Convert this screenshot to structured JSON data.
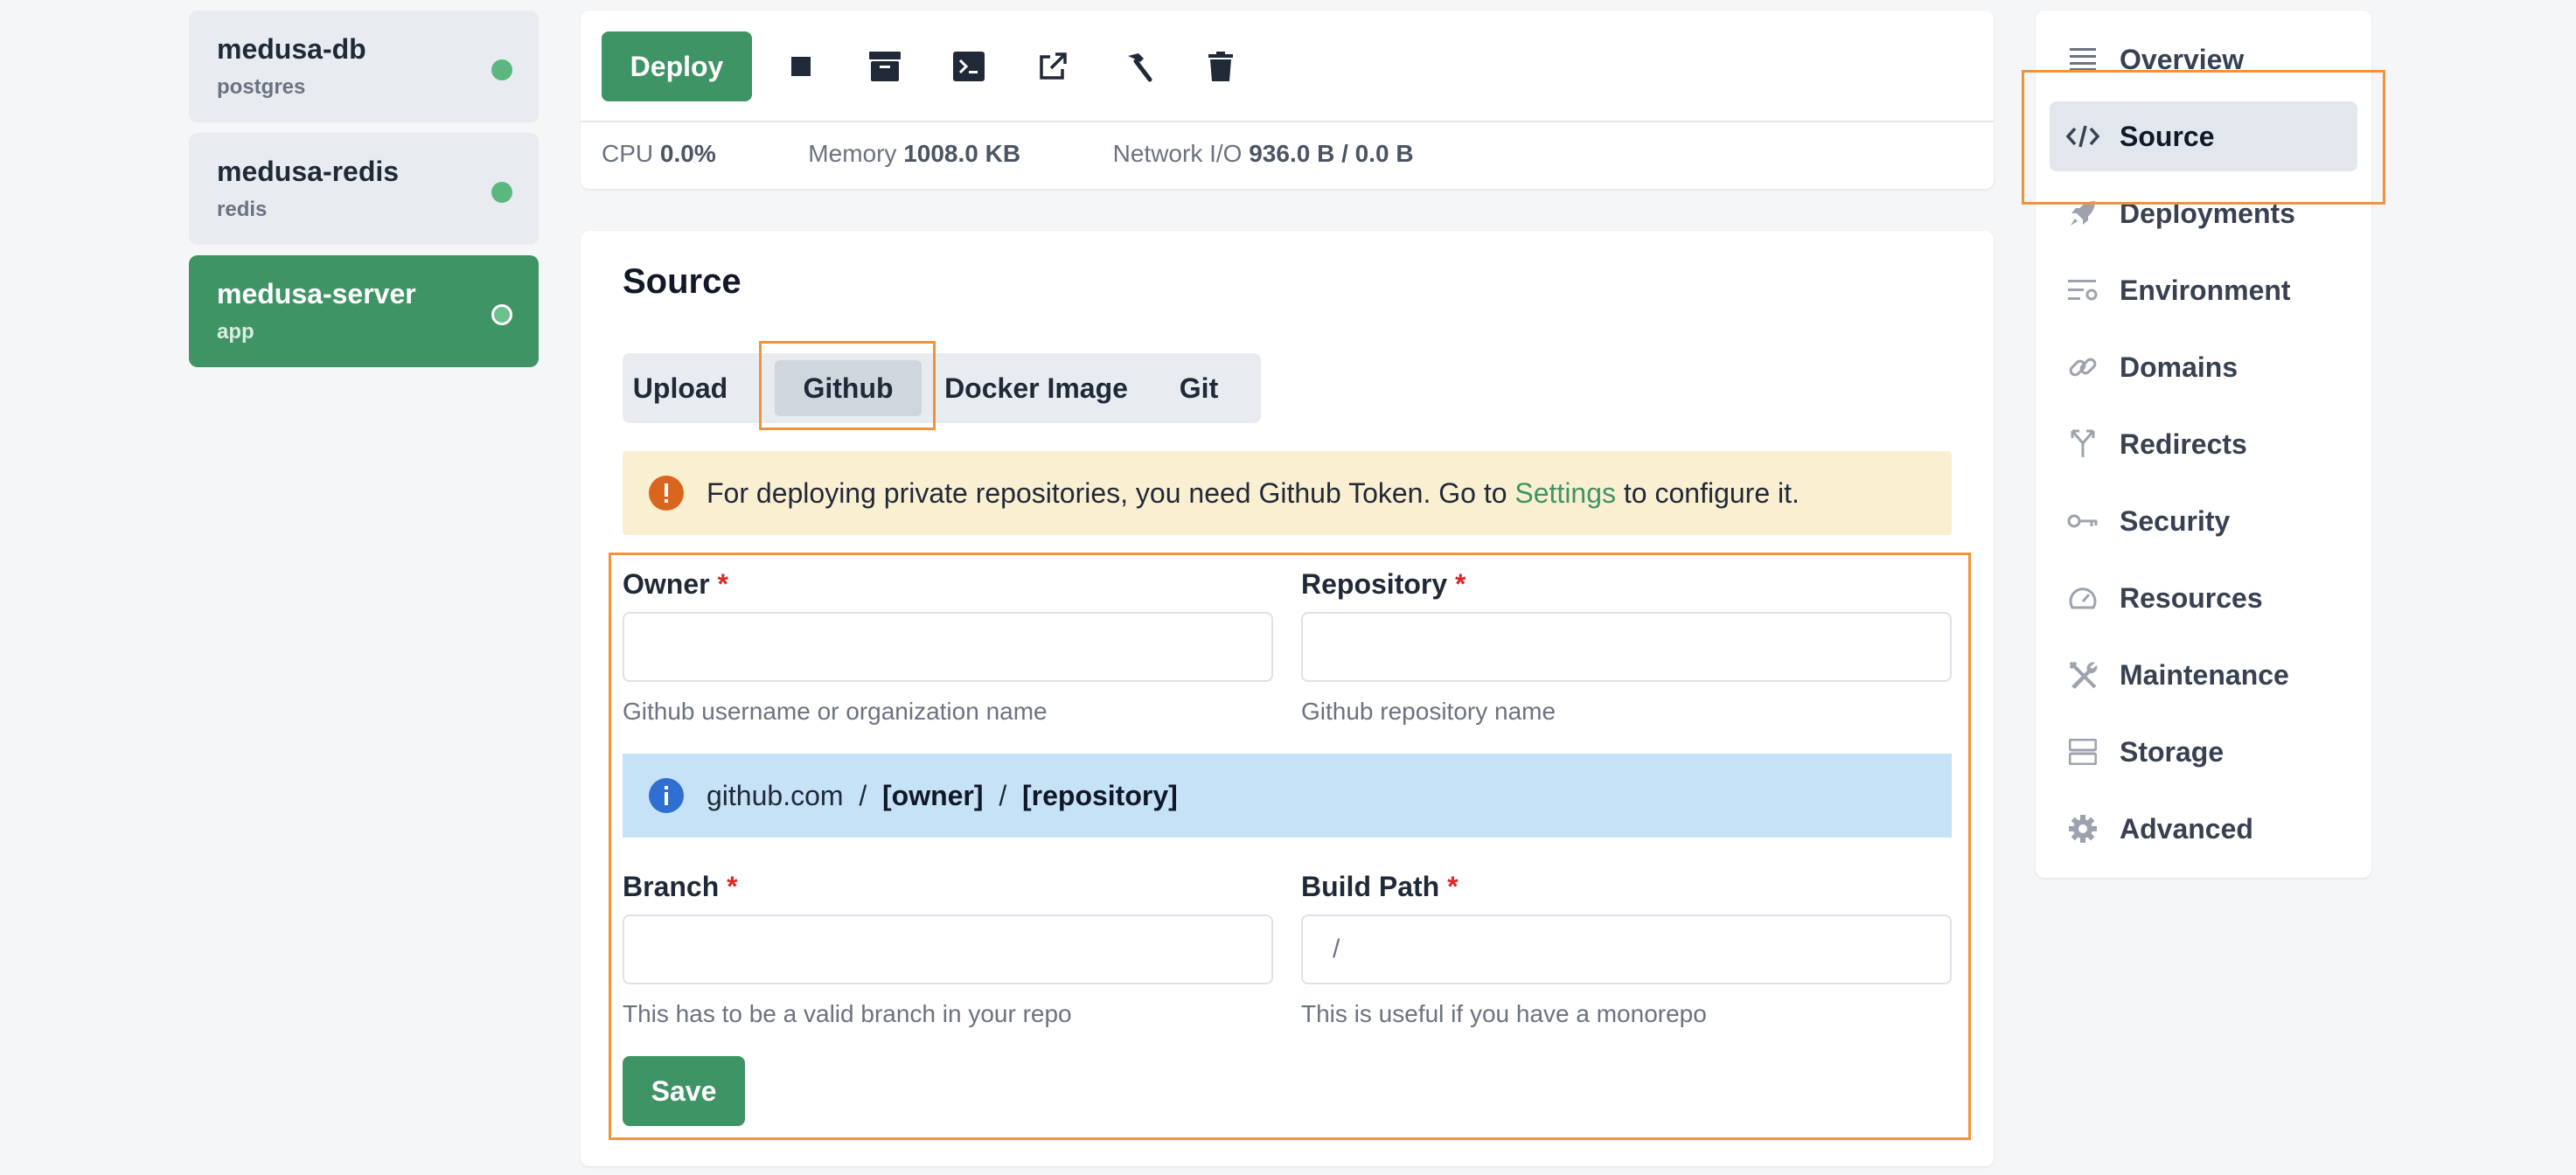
{
  "services": [
    {
      "name": "medusa-db",
      "type": "postgres"
    },
    {
      "name": "medusa-redis",
      "type": "redis"
    },
    {
      "name": "medusa-server",
      "type": "app"
    }
  ],
  "toolbar": {
    "deploy_label": "Deploy",
    "icons": [
      "stop-icon",
      "archive-icon",
      "terminal-icon",
      "external-link-icon",
      "hammer-icon",
      "trash-icon"
    ]
  },
  "stats": {
    "cpu_label": "CPU",
    "cpu_value": "0.0%",
    "memory_label": "Memory",
    "memory_value": "1008.0 KB",
    "network_label": "Network I/O",
    "network_value": "936.0 B / 0.0 B"
  },
  "source": {
    "title": "Source",
    "tabs": [
      "Upload",
      "Github",
      "Docker Image",
      "Git"
    ],
    "active_tab": "Github",
    "warning": {
      "before": "For deploying private repositories, you need Github Token. Go to ",
      "link": "Settings",
      "after": " to configure it."
    },
    "owner": {
      "label": "Owner",
      "hint": "Github username or organization name",
      "value": ""
    },
    "repository": {
      "label": "Repository",
      "hint": "Github repository name",
      "value": ""
    },
    "url_preview": {
      "domain": "github.com",
      "sep": "/",
      "owner": "[owner]",
      "repo": "[repository]"
    },
    "branch": {
      "label": "Branch",
      "hint": "This has to be a valid branch in your repo",
      "value": ""
    },
    "build_path": {
      "label": "Build Path",
      "hint": "This is useful if you have a monorepo",
      "value": "/"
    },
    "required_mark": "*",
    "save_label": "Save"
  },
  "nav": [
    {
      "label": "Overview",
      "icon": "list-icon"
    },
    {
      "label": "Source",
      "icon": "code-icon",
      "active": true
    },
    {
      "label": "Deployments",
      "icon": "rocket-icon"
    },
    {
      "label": "Environment",
      "icon": "env-settings-icon"
    },
    {
      "label": "Domains",
      "icon": "link-icon"
    },
    {
      "label": "Redirects",
      "icon": "redirect-icon"
    },
    {
      "label": "Security",
      "icon": "key-icon"
    },
    {
      "label": "Resources",
      "icon": "gauge-icon"
    },
    {
      "label": "Maintenance",
      "icon": "tools-icon"
    },
    {
      "label": "Storage",
      "icon": "storage-icon"
    },
    {
      "label": "Advanced",
      "icon": "gear-icon"
    }
  ],
  "colors": {
    "primary": "#3f9466",
    "warning_bg": "#fbefd2",
    "info_bg": "#c6e2f7",
    "highlight": "#f0943a",
    "required": "#dc2626"
  }
}
